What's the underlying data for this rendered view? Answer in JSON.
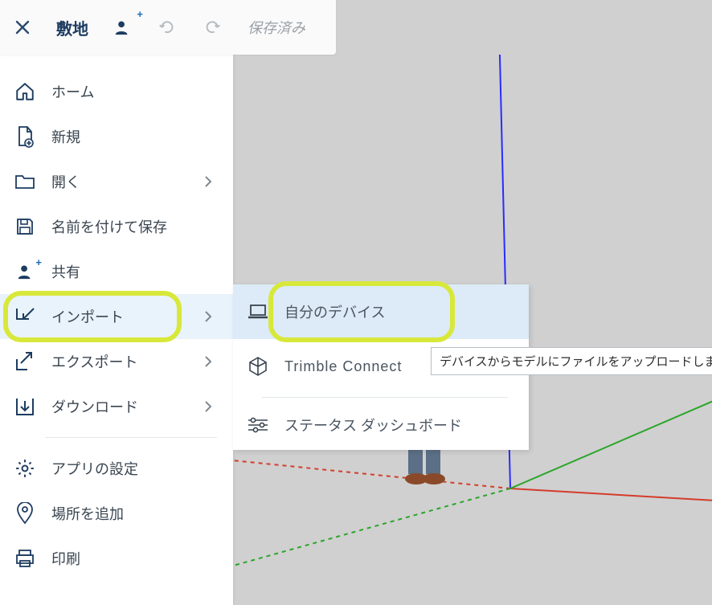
{
  "topbar": {
    "title": "敷地",
    "saved_label": "保存済み"
  },
  "menu": {
    "items": [
      {
        "id": "home",
        "label": "ホーム",
        "chevron": false
      },
      {
        "id": "new",
        "label": "新規",
        "chevron": false
      },
      {
        "id": "open",
        "label": "開く",
        "chevron": true
      },
      {
        "id": "saveas",
        "label": "名前を付けて保存",
        "chevron": false
      },
      {
        "id": "share",
        "label": "共有",
        "chevron": false
      },
      {
        "id": "import",
        "label": "インポート",
        "chevron": true,
        "highlight": true
      },
      {
        "id": "export",
        "label": "エクスポート",
        "chevron": true
      },
      {
        "id": "download",
        "label": "ダウンロード",
        "chevron": true
      }
    ],
    "items2": [
      {
        "id": "settings",
        "label": "アプリの設定"
      },
      {
        "id": "location",
        "label": "場所を追加"
      },
      {
        "id": "print",
        "label": "印刷"
      }
    ]
  },
  "submenu": {
    "my_device": "自分のデバイス",
    "trimble_connect": "Trimble Connect",
    "status_dashboard": "ステータス ダッシュボード"
  },
  "tooltip": "デバイスからモデルにファイルをアップロードします。",
  "colors": {
    "highlight_main": "#e9f3fb",
    "highlight_sub": "#dcebf7",
    "ring": "#d8e83a",
    "axis_blue": "#2b2bff",
    "axis_green": "#2aa52a",
    "axis_red": "#d43c2a"
  }
}
